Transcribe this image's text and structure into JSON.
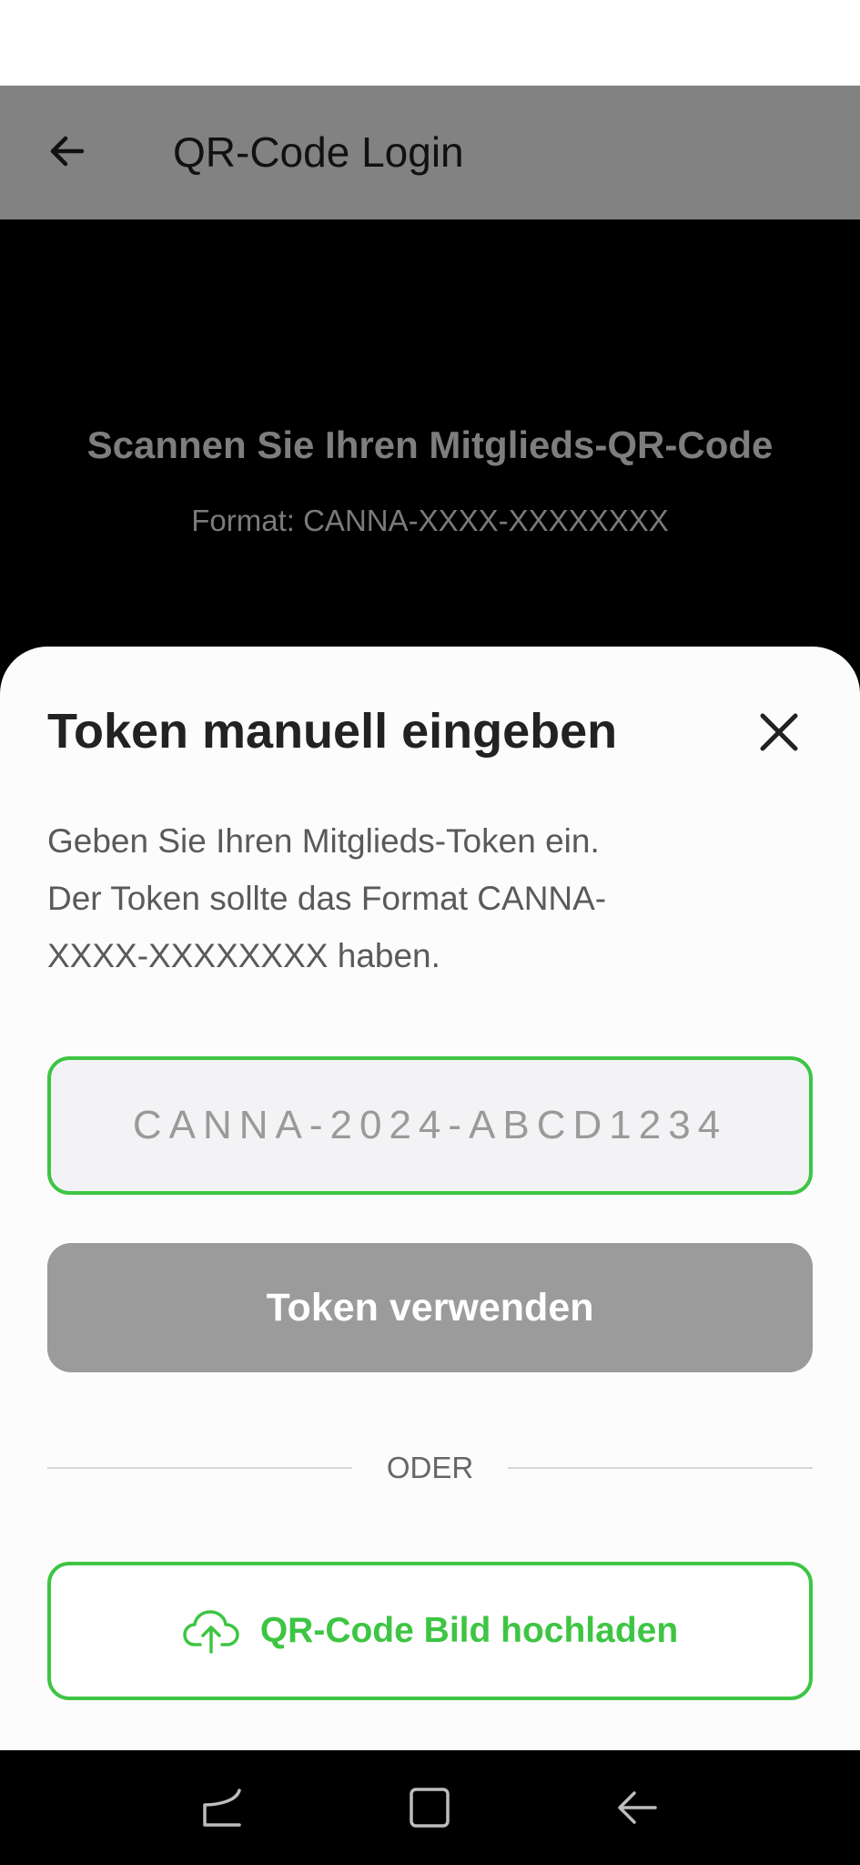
{
  "app_bar": {
    "title": "QR-Code Login",
    "back_icon": "arrow-left-icon"
  },
  "scanner": {
    "title": "Scannen Sie Ihren Mitglieds-QR-Code",
    "format_hint": "Format: CANNA-XXXX-XXXXXXXX"
  },
  "sheet": {
    "title": "Token manuell eingeben",
    "close_icon": "close-icon",
    "description": "Geben Sie Ihren Mitglieds-Token ein. Der Token sollte das Format CANNA-XXXX-XXXXXXXX haben.",
    "token_input": {
      "value": "",
      "placeholder": "CANNA-2024-ABCD1234"
    },
    "submit_label": "Token verwenden",
    "divider_text": "ODER",
    "upload_label": "QR-Code Bild hochladen",
    "upload_icon": "cloud-upload-icon"
  },
  "nav_bar": {
    "recents_icon": "recents-icon",
    "home_icon": "home-icon",
    "back_icon": "back-icon"
  },
  "colors": {
    "accent": "#3dc543",
    "app_bar_bg": "#828282",
    "disabled_button": "#9b9b9b",
    "sheet_bg": "#fcfcfc"
  }
}
